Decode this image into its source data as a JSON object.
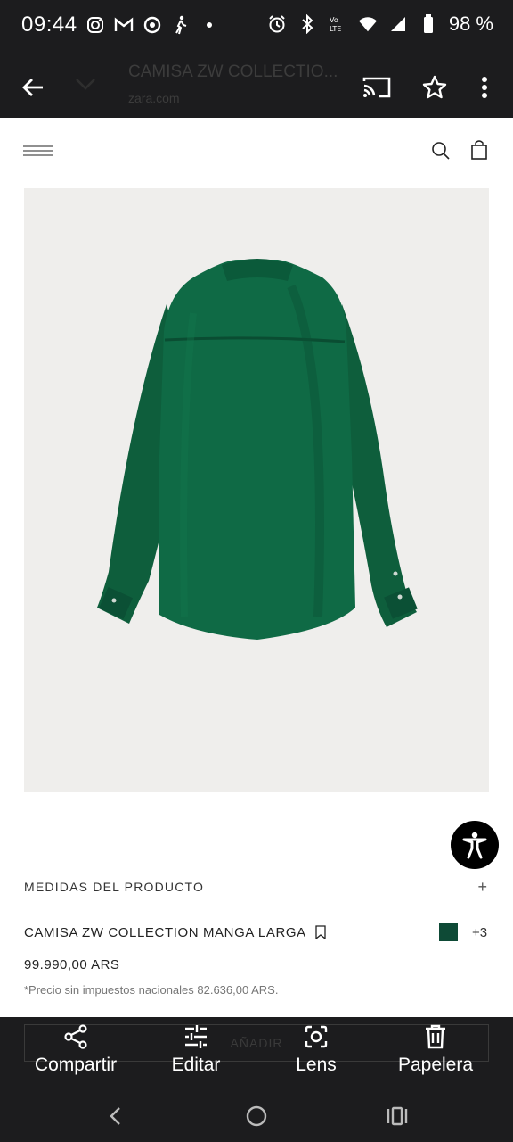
{
  "status_bar": {
    "time": "09:44",
    "battery_text": "98 %",
    "left_icons": [
      "instagram-icon",
      "gmail-icon",
      "chrome-icon",
      "walking-icon",
      "dot-icon"
    ],
    "right_icons": [
      "alarm-icon",
      "bluetooth-icon",
      "volte-icon",
      "wifi-icon",
      "signal-icon",
      "battery-icon"
    ]
  },
  "toolbar": {
    "title": "CAMISA ZW COLLECTIO...",
    "url": "zara.com"
  },
  "product": {
    "measure_label": "MEDIDAS DEL PRODUCTO",
    "measure_plus": "+",
    "name": "CAMISA ZW COLLECTION MANGA LARGA",
    "swatch_color": "#0e4a36",
    "more_colors": "+3",
    "price": "99.990,00 ARS",
    "tax_note": "*Precio sin impuestos nacionales 82.636,00 ARS.",
    "add_button": "AÑADIR",
    "image_bg": "#efeeec",
    "shirt_color": "#0f6a45"
  },
  "actions": {
    "share": "Compartir",
    "edit": "Editar",
    "lens": "Lens",
    "trash": "Papelera"
  }
}
